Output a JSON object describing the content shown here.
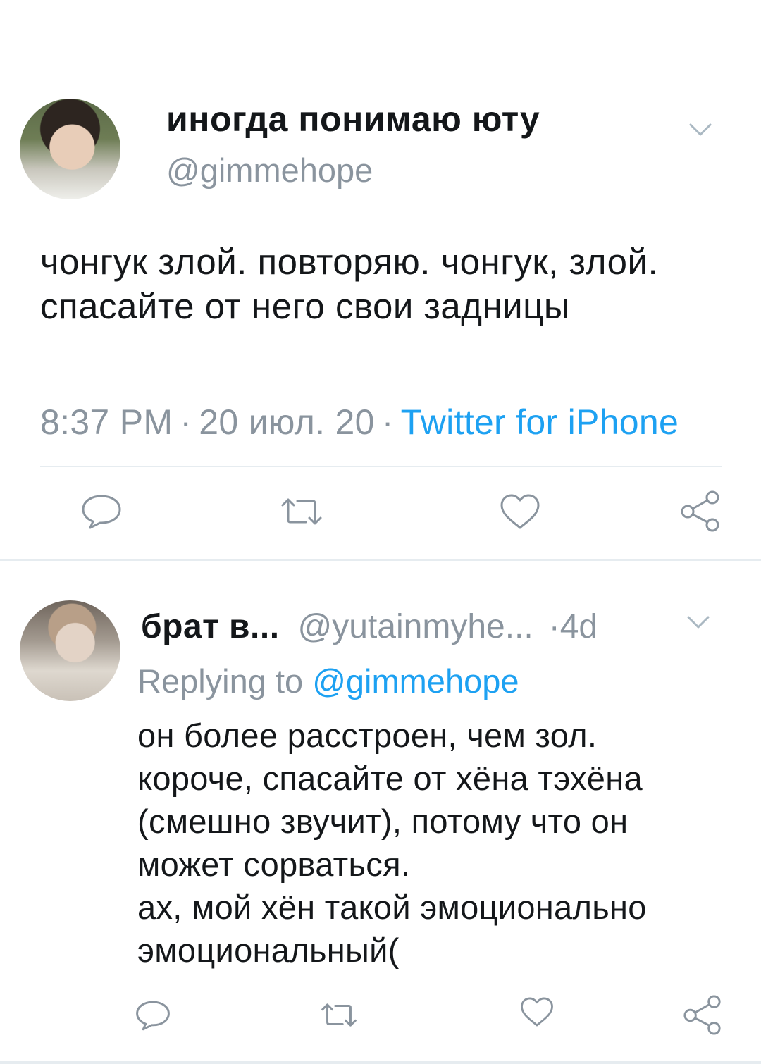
{
  "main_tweet": {
    "display_name": "иногда понимаю юту",
    "handle": "@gimmehope",
    "text": "чонгук злой. повторяю. чонгук, злой. спасайте от него свои задницы",
    "time": "8:37 PM",
    "date": "20 июл. 20",
    "source": "Twitter for iPhone",
    "separator": "·"
  },
  "reply": {
    "display_name": "брат в...",
    "handle": "@yutainmyhe...",
    "age": "4d",
    "separator": "·",
    "replying_label": "Replying to",
    "replying_mention": "@gimmehope",
    "text_lines": [
      "он более расстроен, чем зол.",
      "короче, спасайте от хёна тэхёна",
      "(смешно звучит), потому что он",
      "может сорваться.",
      "ах, мой хён такой эмоционально",
      "эмоциональный("
    ]
  },
  "icons": [
    "chevron-down-icon",
    "reply-icon",
    "retweet-icon",
    "like-icon",
    "share-icon"
  ],
  "colors": {
    "link": "#1da1f2",
    "secondary_text": "#8a949e",
    "icon": "#8a949e",
    "divider": "#e6ecf0"
  }
}
